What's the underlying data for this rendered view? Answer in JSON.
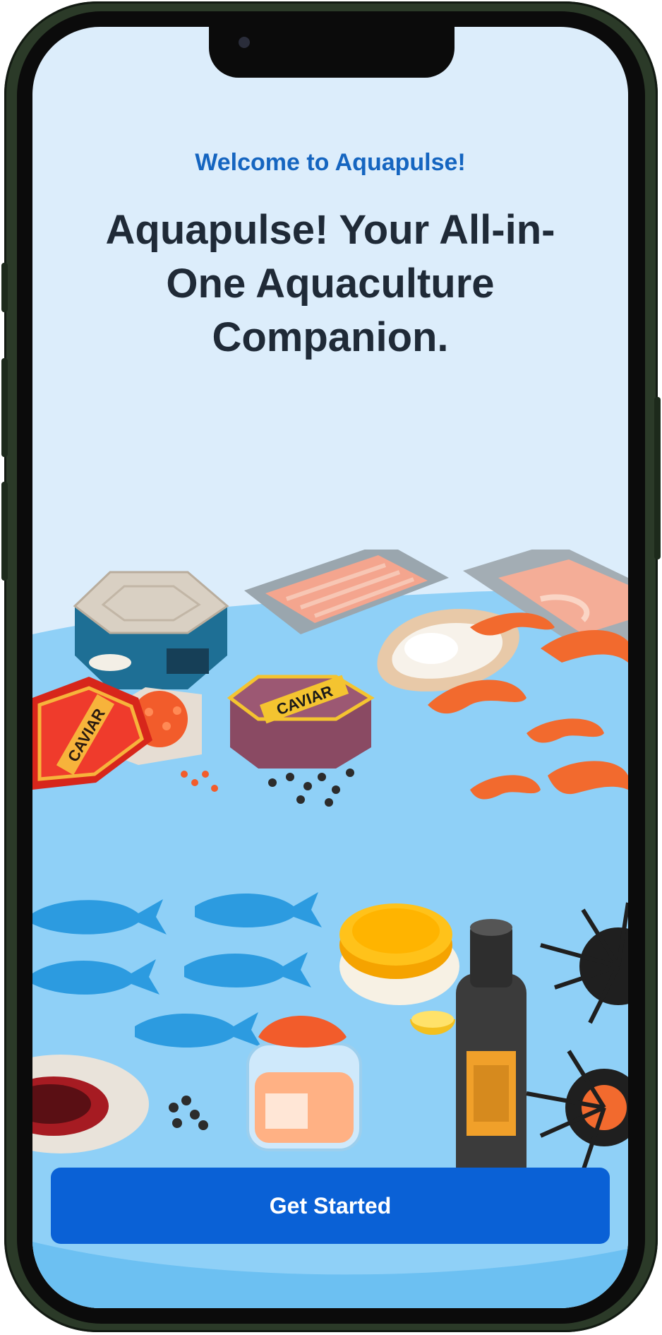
{
  "onboarding": {
    "welcome": "Welcome to Aquapulse!",
    "headline": "Aquapulse! Your All-in-One Aquaculture Companion.",
    "cta_label": "Get Started"
  },
  "illustration": {
    "caviar_label": "CAVIAR"
  },
  "colors": {
    "accent": "#0a61d6",
    "welcome_text": "#1565c0",
    "headline_text": "#1f2a37",
    "screen_bg": "#dcedfb",
    "water": "#8fd0f7"
  }
}
